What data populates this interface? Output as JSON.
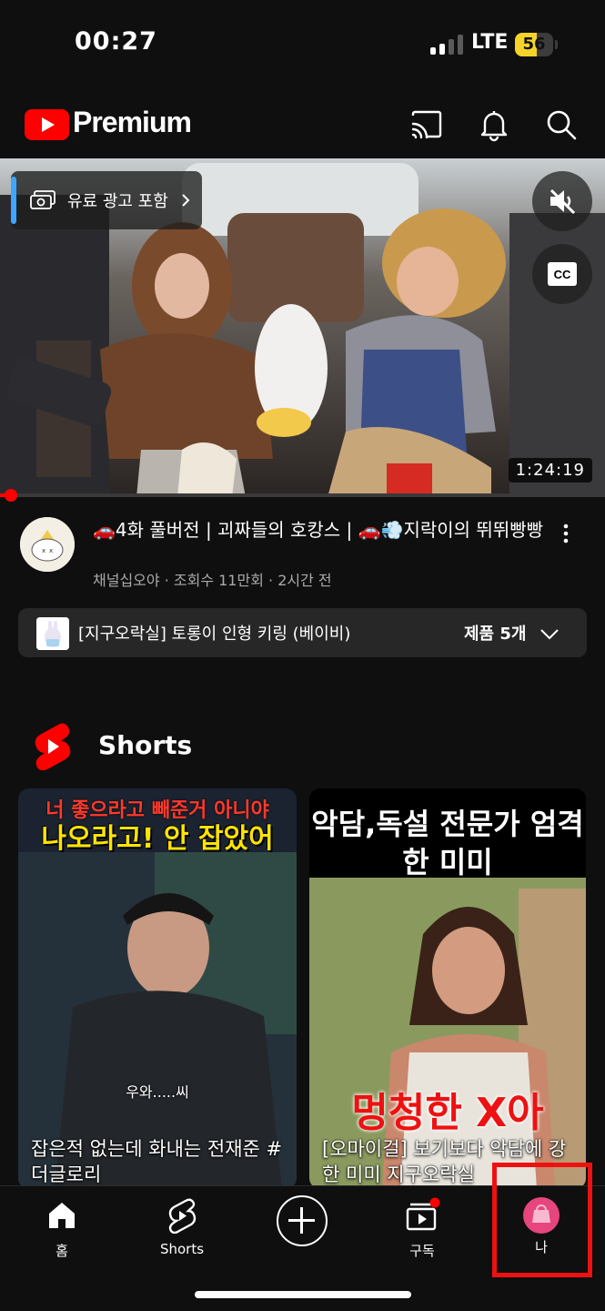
{
  "status_bar": {
    "time": "00:27",
    "network": "LTE",
    "battery_level": "56"
  },
  "app_bar": {
    "brand": "Premium",
    "icons": [
      "cast-icon",
      "bell-icon",
      "search-icon"
    ]
  },
  "player": {
    "ad_label": "유료 광고 포함",
    "duration": "1:24:19",
    "muted": true,
    "progress_fraction": 0.01
  },
  "video": {
    "title": "🚗4화 풀버전 | 괴짜들의 호캉스 | 🚗💨지락이의 뛰뛰빵빵",
    "channel": "채널십오야",
    "views": "조회수 11만회",
    "age": "2시간 전"
  },
  "product": {
    "name": "[지구오락실] 토롱이 인형 키링 (베이비)",
    "count": "제품 5개"
  },
  "shorts": {
    "label": "Shorts",
    "items": [
      {
        "top_line1": "너 좋으라고 빼준거 아니야",
        "top_line2": "나오라고! 안 잡았어",
        "subtitle": "우와.....씨",
        "caption": "잡은적 없는데 화내는 전재준 #더글로리"
      },
      {
        "top_text": "악담,독설 전문가 엄격한 미미",
        "overlay": "멍청한 X아",
        "caption": "[오마이걸] 보기보다 악담에 강한 미미 지구오락실"
      }
    ]
  },
  "bottom_nav": {
    "items": [
      {
        "label": "홈"
      },
      {
        "label": "Shorts"
      },
      {
        "label": ""
      },
      {
        "label": "구독"
      },
      {
        "label": "나"
      }
    ]
  },
  "colors": {
    "background": "#0f0f0f",
    "brand_red": "#ff0000",
    "accent_blue": "#3ea6ff",
    "battery_yellow": "#f5d42a",
    "highlight_red": "#ee1111"
  }
}
